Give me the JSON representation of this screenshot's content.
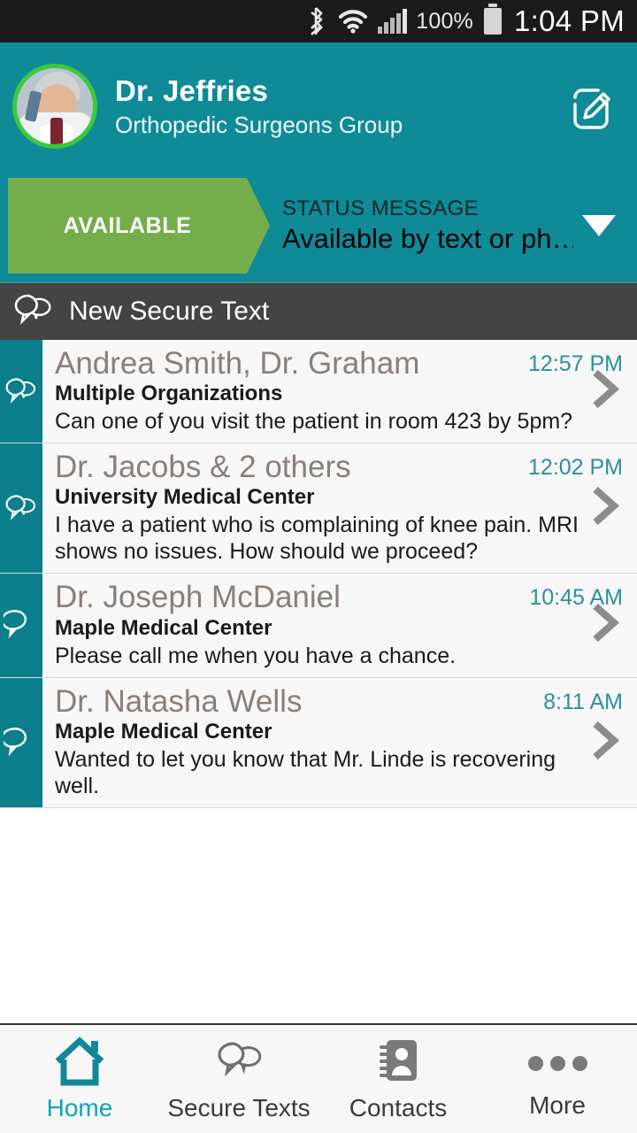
{
  "statusbar": {
    "bluetooth_icon": "bluetooth-icon",
    "wifi_icon": "wifi-icon",
    "signal_icon": "signal-bars-icon",
    "battery_percent": "100%",
    "battery_icon": "battery-full-icon",
    "time": "1:04 PM"
  },
  "header": {
    "avatar_name": "user-avatar",
    "name": "Dr. Jeffries",
    "organization": "Orthopedic Surgeons Group",
    "compose_icon": "compose-edit-icon",
    "background_color": "#0e8b97",
    "avatar_ring_color": "#3cc93c"
  },
  "status": {
    "availability_label": "AVAILABLE",
    "availability_color": "#74ae4b",
    "message_label": "STATUS MESSAGE",
    "message_value": "Available by text or ph…",
    "dropdown_icon": "chevron-down-icon"
  },
  "new_secure_text": {
    "label": "New Secure Text",
    "icon": "group-chat-bubbles-icon",
    "background_color": "#444444"
  },
  "conversations": [
    {
      "icon": "group-chat-bubbles-icon",
      "name": "Andrea Smith, Dr. Graham",
      "organization": "Multiple Organizations",
      "preview": "Can one of you visit the patient in room 423 by 5pm?",
      "time": "12:57 PM",
      "chevron_icon": "chevron-right-icon"
    },
    {
      "icon": "group-chat-bubbles-icon",
      "name": "Dr. Jacobs & 2 others",
      "organization": "University Medical Center",
      "preview": "I have a patient who is complaining of knee pain. MRI shows no issues. How should we proceed?",
      "time": "12:02 PM",
      "chevron_icon": "chevron-right-icon"
    },
    {
      "icon": "chat-bubble-icon",
      "name": "Dr. Joseph McDaniel",
      "organization": "Maple Medical Center",
      "preview": "Please call me when you have a chance.",
      "time": "10:45 AM",
      "chevron_icon": "chevron-right-icon"
    },
    {
      "icon": "chat-bubble-icon",
      "name": "Dr. Natasha Wells",
      "organization": "Maple Medical Center",
      "preview": "Wanted to let you know that Mr. Linde is recovering well.",
      "time": "8:11 AM",
      "chevron_icon": "chevron-right-icon"
    }
  ],
  "tabbar": {
    "active_color": "#13a3b5",
    "items": [
      {
        "label": "Home",
        "icon": "home-icon",
        "active": true
      },
      {
        "label": "Secure Texts",
        "icon": "chat-bubbles-icon",
        "active": false
      },
      {
        "label": "Contacts",
        "icon": "address-book-icon",
        "active": false
      },
      {
        "label": "More",
        "icon": "more-dots-icon",
        "active": false
      }
    ]
  }
}
